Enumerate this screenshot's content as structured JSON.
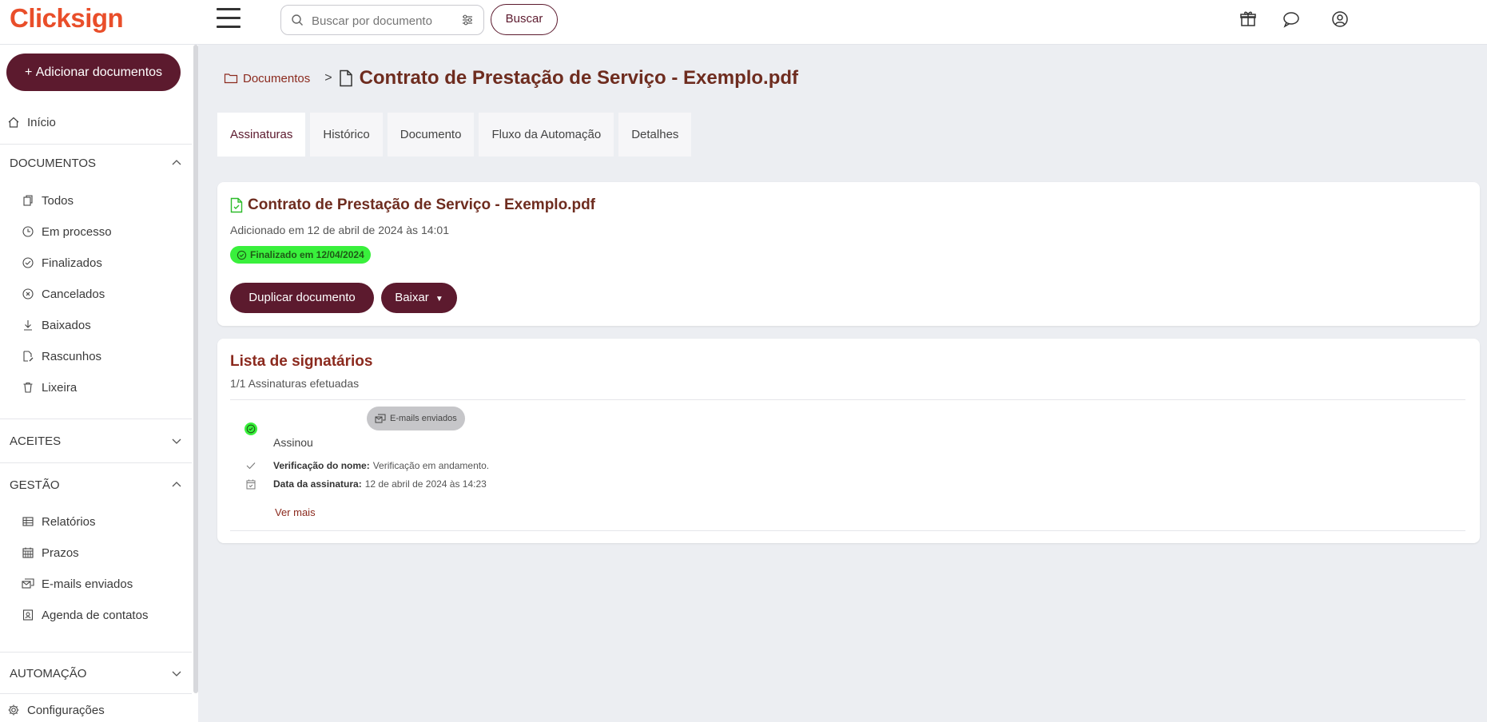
{
  "app": {
    "logo": "Clicksign"
  },
  "search": {
    "placeholder": "Buscar por documento",
    "button_label": "Buscar"
  },
  "header_icons": [
    "gift-icon",
    "chat-icon",
    "user-icon"
  ],
  "sidebar": {
    "add_button": "Adicionar documentos",
    "home": "Início",
    "sections": {
      "documentos": "DOCUMENTOS",
      "aceites": "ACEITES",
      "gestao": "GESTÃO",
      "automacao": "AUTOMAÇÃO"
    },
    "documentos_items": [
      {
        "label": "Todos",
        "icon": "documents-icon"
      },
      {
        "label": "Em processo",
        "icon": "clock-icon"
      },
      {
        "label": "Finalizados",
        "icon": "check-circle-icon"
      },
      {
        "label": "Cancelados",
        "icon": "x-circle-icon"
      },
      {
        "label": "Baixados",
        "icon": "download-icon"
      },
      {
        "label": "Rascunhos",
        "icon": "draft-icon"
      },
      {
        "label": "Lixeira",
        "icon": "trash-icon"
      }
    ],
    "gestao_items": [
      {
        "label": "Relatórios",
        "icon": "table-icon"
      },
      {
        "label": "Prazos",
        "icon": "calendar-icon"
      },
      {
        "label": "E-mails enviados",
        "icon": "email-sent-icon"
      },
      {
        "label": "Agenda de contatos",
        "icon": "contacts-icon"
      }
    ],
    "settings": "Configurações"
  },
  "breadcrumb": {
    "link": "Documentos",
    "title": "Contrato de Prestação de Serviço - Exemplo.pdf"
  },
  "tabs": [
    "Assinaturas",
    "Histórico",
    "Documento",
    "Fluxo da Automação",
    "Detalhes"
  ],
  "document": {
    "title": "Contrato de Prestação de Serviço - Exemplo.pdf",
    "added": "Adicionado em 12 de abril de 2024 às 14:01",
    "status": "Finalizado em 12/04/2024",
    "duplicate_button": "Duplicar documento",
    "download_button": "Baixar"
  },
  "signers": {
    "title": "Lista de signatários",
    "summary": "1/1 Assinaturas efetuadas",
    "email_chip": "E-mails enviados",
    "status": "Assinou",
    "name_check_label": "Verificação do nome:",
    "name_check_value": "Verificação em andamento.",
    "date_label": "Data da assinatura:",
    "date_value": "12 de abril de 2024 às 14:23",
    "more": "Ver mais"
  },
  "colors": {
    "brand": "#e94e2a",
    "primary": "#5c1a2e",
    "success": "#39f03c",
    "title": "#6e2c1f"
  }
}
